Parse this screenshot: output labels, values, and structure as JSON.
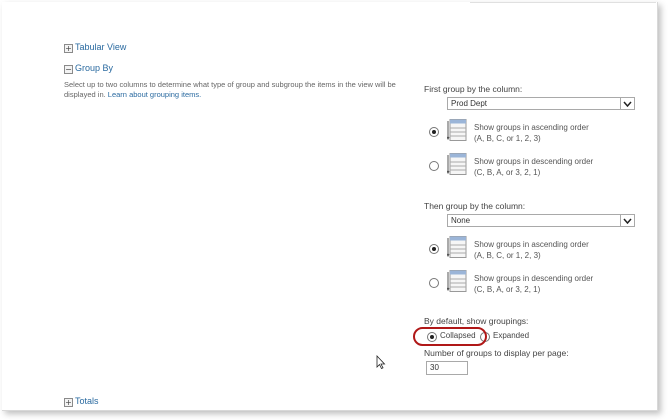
{
  "sections": {
    "tabular_view": {
      "label": "Tabular View",
      "expand_icon": "plus-icon"
    },
    "group_by": {
      "label": "Group By",
      "expand_icon": "minus-icon",
      "description": "Select up to two columns to determine what type of group and subgroup the items in the view will be displayed in.",
      "learn_link": "Learn about grouping items."
    },
    "totals": {
      "label": "Totals",
      "expand_icon": "plus-icon"
    }
  },
  "first_group": {
    "label": "First group by the column:",
    "selected": "Prod Dept",
    "options": [
      {
        "title": "Show groups in ascending order",
        "sub": "(A, B, C, or 1, 2, 3)",
        "checked": true
      },
      {
        "title": "Show groups in descending order",
        "sub": "(C, B, A, or 3, 2, 1)",
        "checked": false
      }
    ]
  },
  "then_group": {
    "label": "Then group by the column:",
    "selected": "None",
    "options": [
      {
        "title": "Show groups in ascending order",
        "sub": "(A, B, C, or 1, 2, 3)",
        "checked": true
      },
      {
        "title": "Show groups in descending order",
        "sub": "(C, B, A, or 3, 2, 1)",
        "checked": false
      }
    ]
  },
  "default_show": {
    "label": "By default, show groupings:",
    "collapsed": "Collapsed",
    "expanded": "Expanded",
    "selected": "Collapsed"
  },
  "groups_per_page": {
    "label": "Number of groups to display per page:",
    "value": "30"
  },
  "colors": {
    "link": "#2a6aa0",
    "highlight": "#b01818"
  }
}
